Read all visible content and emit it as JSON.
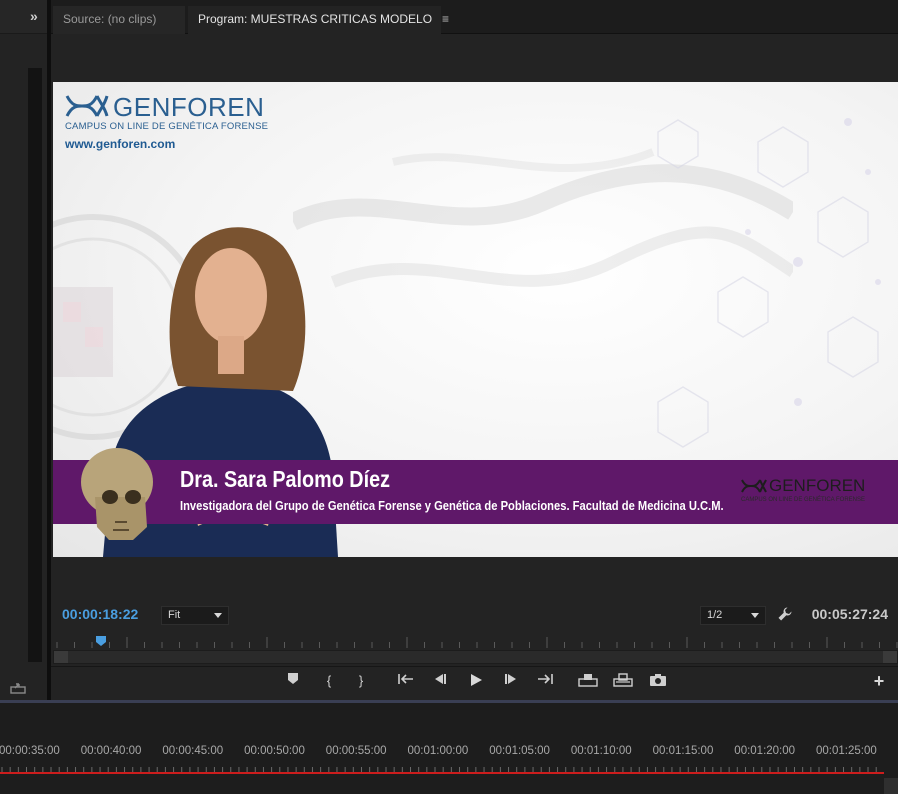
{
  "left_panel": {
    "overflow_label": "»"
  },
  "monitor": {
    "tabs": [
      {
        "label": "Source: (no clips)"
      },
      {
        "label": "Program: MUESTRAS CRITICAS MODELO",
        "menu": "≡"
      }
    ]
  },
  "video": {
    "logo": {
      "brand": "GENFOREN",
      "tagline": "CAMPUS ON LINE DE GENÉTICA FORENSE",
      "url": "www.genforen.com"
    },
    "lower_third": {
      "name": "Dra. Sara Palomo Díez",
      "role": "Investigadora del Grupo de Genética Forense y Genética de Poblaciones. Facultad de Medicina U.C.M.",
      "mini_brand": "GENFOREN",
      "mini_tagline": "CAMPUS ON LINE DE GENÉTICA FORENSE"
    },
    "colors": {
      "lower_third": "#5f1869",
      "logo_blue": "#2a5f90"
    }
  },
  "controls": {
    "current_time": "00:00:18:22",
    "duration": "00:05:27:24",
    "zoom": "Fit",
    "resolution": "1/2",
    "playhead_color": "#4a9ee0",
    "buttons": [
      {
        "name": "add-marker-icon"
      },
      {
        "name": "mark-in-icon",
        "glyph": "{"
      },
      {
        "name": "mark-out-icon",
        "glyph": "}"
      },
      {
        "name": "go-to-in-icon"
      },
      {
        "name": "step-back-icon"
      },
      {
        "name": "play-icon"
      },
      {
        "name": "step-forward-icon"
      },
      {
        "name": "go-to-out-icon"
      },
      {
        "name": "lift-icon"
      },
      {
        "name": "extract-icon"
      },
      {
        "name": "export-frame-icon"
      }
    ],
    "add_label": "+"
  },
  "timeline": {
    "labels": [
      "00:00:35:00",
      "00:00:40:00",
      "00:00:45:00",
      "00:00:50:00",
      "00:00:55:00",
      "00:01:00:00",
      "00:01:05:00",
      "00:01:10:00",
      "00:01:15:00",
      "00:01:20:00",
      "00:01:25:00"
    ],
    "in_out_color": "#cc1d1d"
  }
}
